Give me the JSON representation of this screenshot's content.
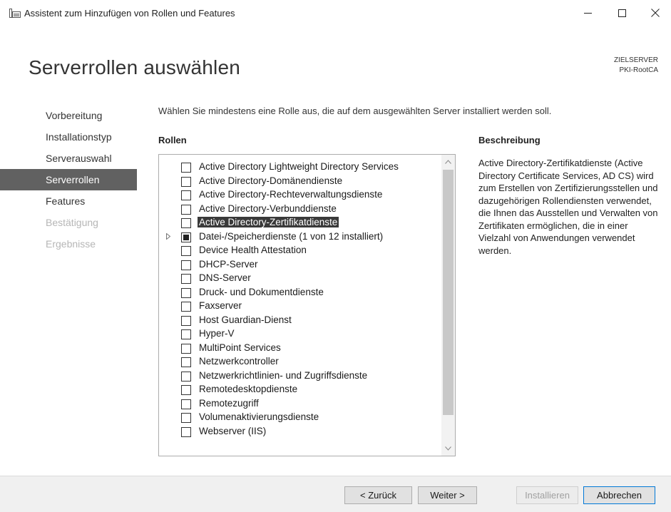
{
  "window": {
    "title": "Assistent zum Hinzufügen von Rollen und Features",
    "minimize_glyph": "—",
    "maximize_glyph": "☐",
    "close_glyph": "✕",
    "icon": "server-manager-icon"
  },
  "page": {
    "title": "Serverrollen auswählen",
    "target_label": "ZIELSERVER",
    "target_server": "PKI-RootCA"
  },
  "nav": {
    "items": [
      {
        "label": "Vorbereitung",
        "state": "normal"
      },
      {
        "label": "Installationstyp",
        "state": "normal"
      },
      {
        "label": "Serverauswahl",
        "state": "normal"
      },
      {
        "label": "Serverrollen",
        "state": "active"
      },
      {
        "label": "Features",
        "state": "normal"
      },
      {
        "label": "Bestätigung",
        "state": "disabled"
      },
      {
        "label": "Ergebnisse",
        "state": "disabled"
      }
    ]
  },
  "main": {
    "instruction": "Wählen Sie mindestens eine Rolle aus, die auf dem ausgewählten Server installiert werden soll.",
    "roles_header": "Rollen",
    "roles": [
      {
        "label": "Active Directory Lightweight Directory Services",
        "checked": false
      },
      {
        "label": "Active Directory-Domänendienste",
        "checked": false
      },
      {
        "label": "Active Directory-Rechteverwaltungsdienste",
        "checked": false
      },
      {
        "label": "Active Directory-Verbunddienste",
        "checked": false
      },
      {
        "label": "Active Directory-Zertifikatdienste",
        "checked": false,
        "selected": true
      },
      {
        "label": "Datei-/Speicherdienste (1 von 12 installiert)",
        "checked": "partial",
        "expandable": true
      },
      {
        "label": "Device Health Attestation",
        "checked": false
      },
      {
        "label": "DHCP-Server",
        "checked": false
      },
      {
        "label": "DNS-Server",
        "checked": false
      },
      {
        "label": "Druck- und Dokumentdienste",
        "checked": false
      },
      {
        "label": "Faxserver",
        "checked": false
      },
      {
        "label": "Host Guardian-Dienst",
        "checked": false
      },
      {
        "label": "Hyper-V",
        "checked": false
      },
      {
        "label": "MultiPoint Services",
        "checked": false
      },
      {
        "label": "Netzwerkcontroller",
        "checked": false
      },
      {
        "label": "Netzwerkrichtlinien- und Zugriffsdienste",
        "checked": false
      },
      {
        "label": "Remotedesktopdienste",
        "checked": false
      },
      {
        "label": "Remotezugriff",
        "checked": false
      },
      {
        "label": "Volumenaktivierungsdienste",
        "checked": false
      },
      {
        "label": "Webserver (IIS)",
        "checked": false
      }
    ],
    "description_header": "Beschreibung",
    "description": "Active Directory-Zertifikatdienste (Active Directory Certificate Services, AD CS) wird zum Erstellen von Zertifizierungsstellen und dazugehörigen Rollendiensten verwendet, die Ihnen das Ausstellen und Verwalten von Zertifikaten ermöglichen, die in einer Vielzahl von Anwendungen verwendet werden."
  },
  "footer": {
    "back_label": "< Zurück",
    "next_label": "Weiter >",
    "install_label": "Installieren",
    "cancel_label": "Abbrechen"
  },
  "colors": {
    "nav_active_bg": "#616161",
    "selection_bg": "#3a3a3a",
    "footer_bg": "#f0f0f0"
  }
}
